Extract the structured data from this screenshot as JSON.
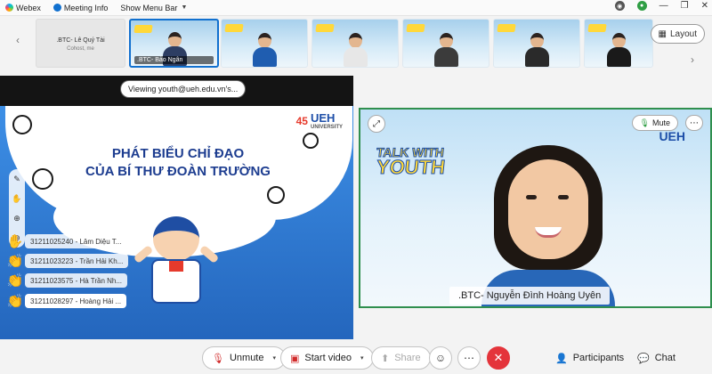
{
  "menubar": {
    "app_name": "Webex",
    "meeting_info": "Meeting Info",
    "show_menu_bar": "Show Menu Bar"
  },
  "strip": {
    "cohost_name": ".BTC- Lê Quý Tài",
    "cohost_role": "Cohost, me",
    "active_label": ".BTC- Bảo Ngân"
  },
  "layout_button": "Layout",
  "share": {
    "viewing": "Viewing youth@ueh.edu.vn's..."
  },
  "slide": {
    "title_line1": "PHÁT BIỂU CHỈ ĐẠO",
    "title_line2": "CỦA BÍ THƯ ĐOÀN TRƯỜNG",
    "logo_number": "45",
    "logo_text": "UEH",
    "logo_sub": "UNIVERSITY"
  },
  "reactions": [
    "31211025240 - Lâm Diệu T...",
    "31211023223 - Trần Hải Kh...",
    "31211023575 - Hà Trần Nh...",
    "31211028297 - Hoàng Hải ..."
  ],
  "speaker": {
    "mute_label": "Mute",
    "name": ".BTC- Nguyễn Đình Hoàng Uyên",
    "brand_line1": "TALK WITH",
    "brand_line2": "YOUTH",
    "ueh": "UEH"
  },
  "toolbar": {
    "unmute": "Unmute",
    "start_video": "Start video",
    "share": "Share",
    "participants": "Participants",
    "chat": "Chat"
  }
}
